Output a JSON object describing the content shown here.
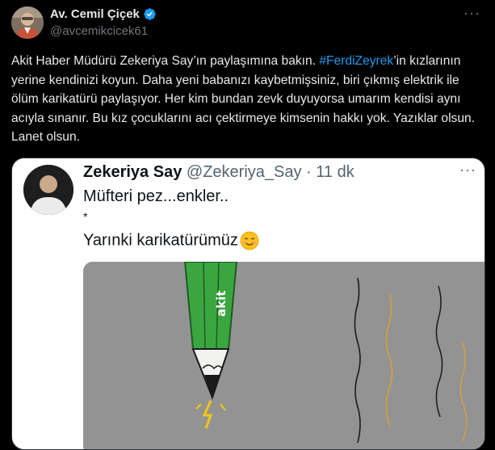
{
  "author": {
    "display_name": "Av. Cemil Çiçek",
    "handle": "@avcemikcicek61"
  },
  "more_label": "···",
  "tweet": {
    "text_before": "Akit Haber Müdürü Zekeriya Say’ın paylaşımına bakın. ",
    "hashtag": "#FerdiZeyrek",
    "text_after": "’in kızlarının yerine kendinizi koyun. Daha yeni babanızı kaybetmişsiniz, biri çıkmış elektrik ile ölüm karikatürü paylaşıyor. Her kim bundan zevk duyuyorsa umarım kendisi aynı acıyla sınanır. Bu kız çocuklarını acı çektirmeye kimsenin hakkı yok. Yazıklar olsun. Lanet olsun."
  },
  "quoted": {
    "display_name": "Zekeriya Say",
    "handle": "@Zekeriya_Say",
    "separator": " · ",
    "time": "11 dk",
    "line1": "Müfteri pez...enkler..",
    "line2": "*",
    "line3": "Yarınki karikatürümüz",
    "emoji": "smiling-face-icon",
    "cartoon_pencil_text": "akit"
  },
  "colors": {
    "background": "#000000",
    "text": "#e7e9ea",
    "secondary": "#71767b",
    "link": "#1d9bf0",
    "verified": "#1d9bf0",
    "pencil_green": "#3aa640",
    "cartoon_bg": "#909090"
  }
}
